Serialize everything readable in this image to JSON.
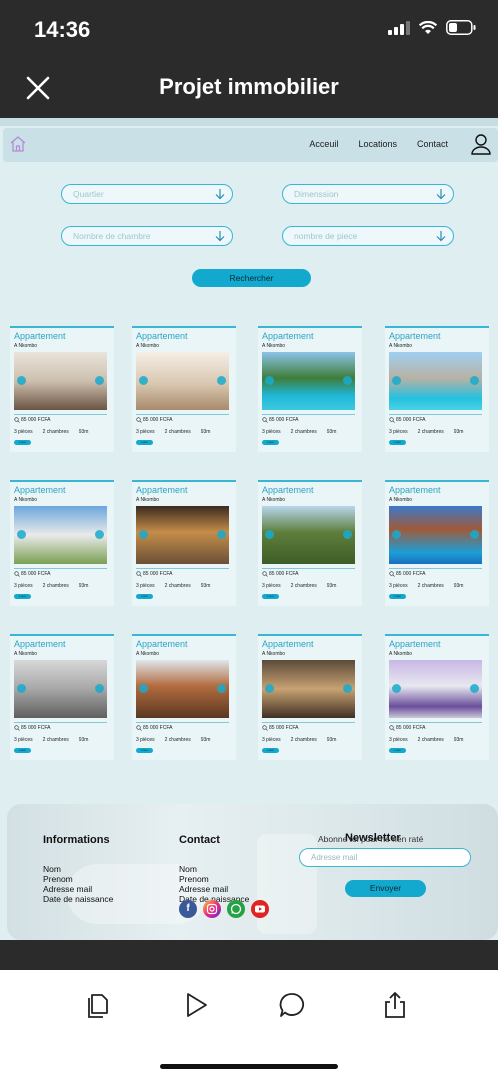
{
  "status": {
    "time": "14:36"
  },
  "header": {
    "title": "Projet immobilier"
  },
  "site_nav": {
    "links": [
      "Acceuil",
      "Locations",
      "Contact"
    ]
  },
  "filters": {
    "quartier": "Quartier",
    "dimension": "Dimenssion",
    "chambres": "Nombre de chambre",
    "pieces": "nombre de piece",
    "search_button": "Rechercher"
  },
  "listings": [
    {
      "type": "Appartement",
      "location": "A Nkombo",
      "price": "85 000 FCFA",
      "rooms": "3 pièces",
      "bedrooms": "2 chambres",
      "area": "93m",
      "badge": "Loué"
    },
    {
      "type": "Appartement",
      "location": "A Nkombo",
      "price": "85 000 FCFA",
      "rooms": "3 pièces",
      "bedrooms": "2 chambres",
      "area": "93m",
      "badge": "Loué"
    },
    {
      "type": "Appartement",
      "location": "A Nkombo",
      "price": "85 000 FCFA",
      "rooms": "3 pièces",
      "bedrooms": "2 chambres",
      "area": "93m",
      "badge": "Loué"
    },
    {
      "type": "Appartement",
      "location": "A Nkombo",
      "price": "85 000 FCFA",
      "rooms": "3 pièces",
      "bedrooms": "2 chambres",
      "area": "93m",
      "badge": "Loué"
    },
    {
      "type": "Appartement",
      "location": "A Nkombo",
      "price": "85 000 FCFA",
      "rooms": "3 pièces",
      "bedrooms": "2 chambres",
      "area": "93m",
      "badge": "Loué"
    },
    {
      "type": "Appartement",
      "location": "A Nkombo",
      "price": "85 000 FCFA",
      "rooms": "3 pièces",
      "bedrooms": "2 chambres",
      "area": "93m",
      "badge": "Loué"
    },
    {
      "type": "Appartement",
      "location": "A Nkombo",
      "price": "85 000 FCFA",
      "rooms": "3 pièces",
      "bedrooms": "2 chambres",
      "area": "93m",
      "badge": "Loué"
    },
    {
      "type": "Appartement",
      "location": "A Nkombo",
      "price": "85 000 FCFA",
      "rooms": "3 pièces",
      "bedrooms": "2 chambres",
      "area": "93m",
      "badge": "Loué"
    },
    {
      "type": "Appartement",
      "location": "A Nkombo",
      "price": "85 000 FCFA",
      "rooms": "3 pièces",
      "bedrooms": "2 chambres",
      "area": "93m",
      "badge": "Loué"
    },
    {
      "type": "Appartement",
      "location": "A Nkombo",
      "price": "85 000 FCFA",
      "rooms": "3 pièces",
      "bedrooms": "2 chambres",
      "area": "93m",
      "badge": "Loué"
    },
    {
      "type": "Appartement",
      "location": "A Nkombo",
      "price": "85 000 FCFA",
      "rooms": "3 pièces",
      "bedrooms": "2 chambres",
      "area": "93m",
      "badge": "Loué"
    },
    {
      "type": "Appartement",
      "location": "A Nkombo",
      "price": "85 000 FCFA",
      "rooms": "3 pièces",
      "bedrooms": "2 chambres",
      "area": "93m",
      "badge": "Loué"
    }
  ],
  "footer": {
    "informations": {
      "title": "Informations",
      "items": [
        "Nom",
        "Prenom",
        "Adresse mail",
        "Date de naissance"
      ]
    },
    "contact": {
      "title": "Contact",
      "items": [
        "Nom",
        "Prenom",
        "Adresse mail",
        "Date de naissance"
      ]
    },
    "newsletter": {
      "title": "Newsletter",
      "subtitle": "Abonne toi pour ne rien raté",
      "placeholder": "Adresse mail",
      "button": "Envoyer"
    },
    "socials": [
      "facebook-icon",
      "instagram-icon",
      "whatsapp-icon",
      "youtube-icon"
    ]
  },
  "colors": {
    "accent": "#13a9cf",
    "page_bg": "#deeef1",
    "chrome": "#2b2b2b"
  }
}
